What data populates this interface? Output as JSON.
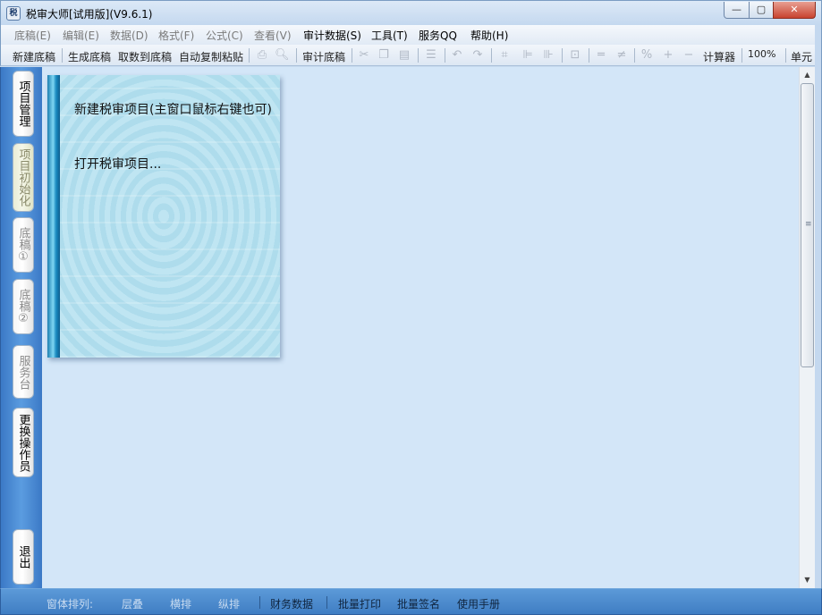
{
  "window": {
    "title": "税审大师[试用版](V9.6.1)",
    "icon_glyph": "税",
    "controls": {
      "minimize": "—",
      "maximize": "▢",
      "close": "✕"
    }
  },
  "menu": [
    {
      "label": "底稿(E)",
      "enabled": false
    },
    {
      "label": "编辑(E)",
      "enabled": false
    },
    {
      "label": "数据(D)",
      "enabled": false
    },
    {
      "label": "格式(F)",
      "enabled": false
    },
    {
      "label": "公式(C)",
      "enabled": false
    },
    {
      "label": "查看(V)",
      "enabled": false
    },
    {
      "label": "审计数据(S)",
      "enabled": true
    },
    {
      "label": "工具(T)",
      "enabled": true
    },
    {
      "label": "服务QQ",
      "enabled": true
    },
    {
      "label": "帮助(H)",
      "enabled": true
    }
  ],
  "toolbar": {
    "new_draft": "新建底稿",
    "generate_draft": "生成底稿",
    "fetch_to_draft": "取数到底稿",
    "auto_copy_paste": "自动复制粘贴",
    "audit_draft": "审计底稿",
    "calculator": "计算器",
    "zoom": "100%",
    "cell": "单元"
  },
  "sidebar": {
    "project_manage": "项目管理",
    "project_init": "项目初始化",
    "draft1": "底稿①",
    "draft2": "底稿②",
    "service_desk": "服务台",
    "change_operator": "更换操作员",
    "exit": "退出"
  },
  "card": {
    "new_project": "新建税审项目(主窗口鼠标右键也可)",
    "open_project": "打开税审项目..."
  },
  "statusbar": {
    "arrange_label": "窗体排列:",
    "cascade": "层叠",
    "tile_h": "横排",
    "tile_v": "纵排",
    "financial_data": "财务数据",
    "batch_print": "批量打印",
    "batch_sign": "批量签名",
    "manual": "使用手册"
  },
  "colors": {
    "sidebar_blue": "#4a8ad4",
    "main_bg": "#d3e6f8",
    "card_bg": "#b3e0ef",
    "statusbar_blue": "#4f8ccc"
  }
}
